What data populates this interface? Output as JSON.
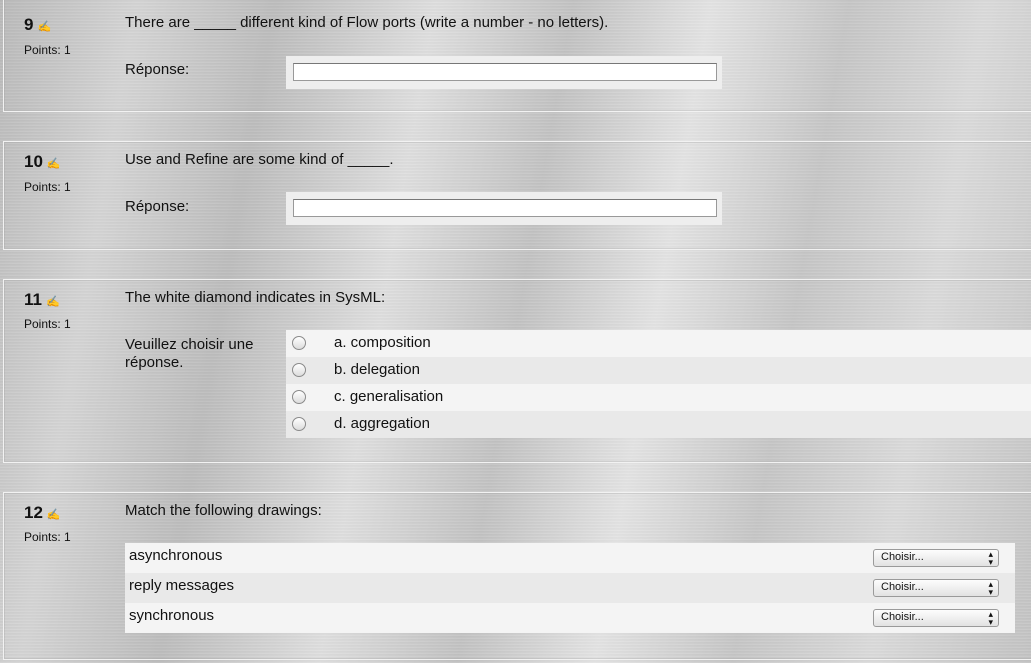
{
  "questions": [
    {
      "number": "9",
      "points": "Points: 1",
      "text": "There are _____ different kind of Flow ports (write a number - no letters).",
      "answer_label": "Réponse:",
      "answer_value": ""
    },
    {
      "number": "10",
      "points": "Points: 1",
      "text": "Use and Refine are some kind of _____.",
      "answer_label": "Réponse:",
      "answer_value": ""
    },
    {
      "number": "11",
      "points": "Points: 1",
      "text": "The white diamond indicates in SysML:",
      "prompt_line1": "Veuillez choisir une",
      "prompt_line2": "réponse.",
      "choices": [
        "a. composition",
        "b. delegation",
        "c. generalisation",
        "d. aggregation"
      ]
    },
    {
      "number": "12",
      "points": "Points: 1",
      "text": "Match the following drawings:",
      "rows": [
        {
          "label": "asynchronous",
          "select": "Choisir..."
        },
        {
          "label": "reply messages",
          "select": "Choisir..."
        },
        {
          "label": "synchronous",
          "select": "Choisir..."
        }
      ]
    }
  ],
  "icons": {
    "edit": "edit-pencil-icon"
  }
}
